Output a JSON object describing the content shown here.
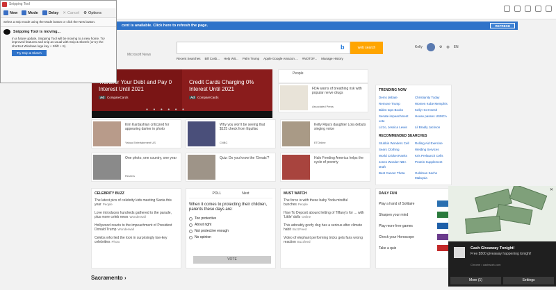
{
  "notification": {
    "text": "cent is available. Click here to refresh the page.",
    "refresh": "REFRESH"
  },
  "msn": {
    "logo_text": "Microsoft News",
    "search_btn": "web search",
    "region": "Kelly",
    "lang": "EN"
  },
  "quick_links": [
    "Recent Searches",
    "Bill Cosb...",
    "Help Wit...",
    "Palm Trump",
    "Apple Google Amazon ...",
    "#NOTOF...",
    "Manage History"
  ],
  "hero": [
    {
      "title": "Transfer Your Debt and Pay 0 Interest Until 2021",
      "ad": "Ad",
      "source": "CompareCards"
    },
    {
      "title": "Credit Cards Charging 0% Interest Until 2021",
      "ad": "Ad",
      "source": "CompareCards"
    }
  ],
  "hero_dots": "● ● ● ● ● ●",
  "cards": [
    {
      "title": "Kim Kardashian criticized for appearing darker in photo",
      "source": "Yahoo Entertainment US"
    },
    {
      "title": "Why you won't be seeing that $125 check from Equifax",
      "source": "CNBC"
    },
    {
      "title": "Kelly Ripa's daughter Lola debuts singing voice",
      "source": "ETOnline"
    },
    {
      "title": "One photo, one country, one year",
      "source": "Reuters"
    },
    {
      "title": "Quiz: Do you know the 'Greats'?",
      "source": ""
    },
    {
      "title": "Halo Feeding America helps the cycle of poverty",
      "source": ""
    },
    {
      "title": "FDA warns of breathing risk with popular nerve drugs",
      "source": "Associated Press"
    },
    {
      "title": "People",
      "source": ""
    }
  ],
  "celeb": {
    "title": "CELEBRITY BUZZ",
    "items": [
      {
        "text": "The latest pics of celebrity kids meeting Santa this year",
        "src": "People"
      },
      {
        "text": "Love introduces hundreds gathered to the parade, plus more celeb news",
        "src": "Wonderwall"
      },
      {
        "text": "Hollywood reacts to the impeachment of President Donald Trump",
        "src": "Wonderwall"
      },
      {
        "text": "Celebs who lied the look in surprisingly low-key celebrities",
        "src": "Photo"
      }
    ]
  },
  "poll": {
    "tab1": "POLL",
    "tab2": "Next",
    "question": "When it comes to protecting their children, parents these days are:",
    "options": [
      "Too protective",
      "About right",
      "Not protective enough",
      "No opinion"
    ],
    "vote": "VOTE"
  },
  "mustwatch": {
    "title": "MUST WATCH",
    "items": [
      {
        "text": "The force is with these baby Yoda mindful bunches",
        "src": "People"
      },
      {
        "text": "How To Deposit abound letting of Tiffany's for ... with 'Little' dolls",
        "src": "Online"
      },
      {
        "text": "This adorably goofy dog has a serious after climate habit",
        "src": "BuzzFeed"
      },
      {
        "text": "Video of elephant performing tricks gets fans wrong reaction",
        "src": "Buzzfeed"
      }
    ]
  },
  "trending": {
    "title": "TRENDING NOW",
    "items": [
      "Dems debate",
      "Christianity Today",
      "Remove Trump",
      "Women Kobe Memphis",
      "Biden tops Books",
      "Kelly Hot Heesh",
      "Senate impeachment vote",
      "House passes USMCA",
      "Lizzo, Jessica Lewis",
      "Lil Bradly Jackson",
      "Bank Corp"
    ],
    "recommended_title": "RECOMMENDED SEARCHES",
    "recommended": [
      "Stubbin Wonders Cell",
      "Rolling Aid Exercise",
      "Sears Clothing",
      "Welding Services",
      "World Cricket Ranks",
      "Kris Prelaunch Cells",
      "Jones Wonder NBA Draft",
      "Protein Supplement",
      "Best Cancer Theta",
      "Goldman Sachs Malaysia"
    ]
  },
  "dailyfun": {
    "title": "DAILY FUN",
    "items": [
      "Play a hand of Solitaire",
      "Sharpen your mind",
      "Play more free games",
      "Check your Horoscope",
      "Take a quiz"
    ]
  },
  "sacramento": "Sacramento",
  "snip": {
    "title": "Snipping Tool",
    "new": "New",
    "mode": "Mode",
    "delay": "Delay",
    "cancel": "Cancel",
    "options": "Options",
    "hint": "Select a snip mode using the Mode button or click the New button.",
    "moving": "Snipping Tool is moving...",
    "body": "In a future update, Snipping Tool will be moving to a new home. Try improved features and snip as usual with Snip & Sketch (or try the shortcut Windows logo key + Shift + S).",
    "try": "Try Snip & Sketch"
  },
  "toast": {
    "heading": "Cash Giveaway Tonight!",
    "sub": "Free $500 giveaway happening tonight!",
    "site": "Chrome • cashwork.com",
    "more": "More (1)",
    "settings": "Settings"
  }
}
